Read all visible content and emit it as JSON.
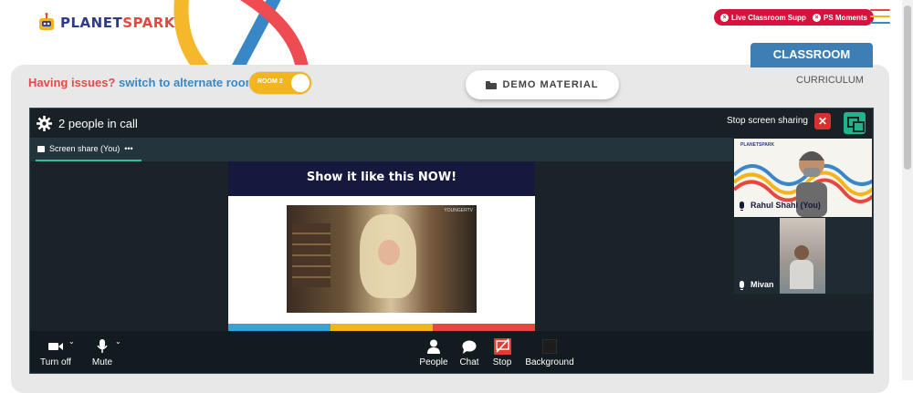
{
  "header": {
    "logo": {
      "part1": "PLANET",
      "part2": "SPARK"
    },
    "live_support_label": "Live Classroom Support",
    "ps_moments_label": "PS Moments"
  },
  "nav": {
    "classroom_tab": "CLASSROOM",
    "curriculum_tab": "CURRICULUM"
  },
  "issues": {
    "question": "Having issues?",
    "suggestion": "switch to alternate room",
    "room_toggle_label": "ROOM 2"
  },
  "demo_material_label": "DEMO MATERIAL",
  "call": {
    "people_count": "2 people in call",
    "stop_sharing_label": "Stop screen sharing",
    "screen_share_tab": "Screen share (You)",
    "tab_more": "•••",
    "slide_title": "Show it like this NOW!",
    "gif_watermark": "YOUNGERTV",
    "participants": [
      {
        "name": "Rahul Shahi (You)"
      },
      {
        "name": "Mivan"
      }
    ],
    "controls": {
      "camera": "Turn off",
      "mic": "Mute",
      "people": "People",
      "chat": "Chat",
      "stop": "Stop",
      "background": "Background"
    }
  },
  "colors": {
    "brand_red": "#d6123e",
    "classroom_blue": "#3d7fb5",
    "accent_green": "#2bc49c",
    "stripe_blue": "#3aa0d8",
    "stripe_yellow": "#f4b41c",
    "stripe_red": "#e8473f"
  }
}
